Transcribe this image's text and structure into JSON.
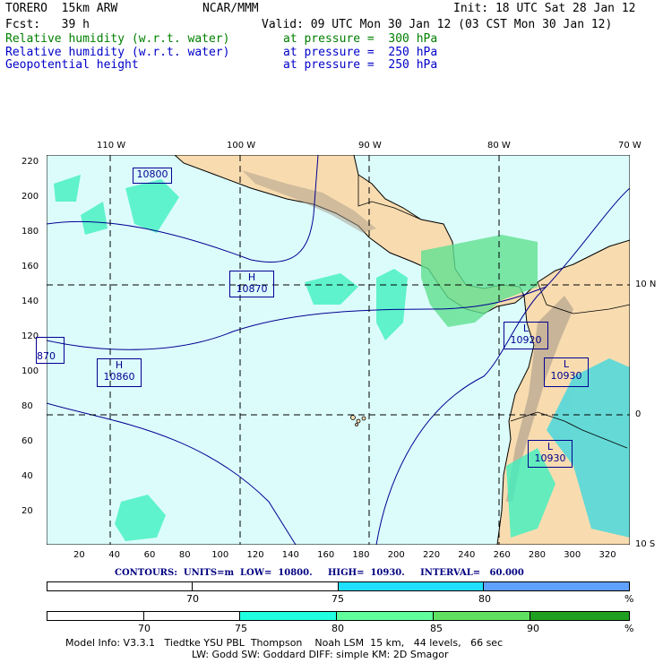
{
  "header": {
    "model": "TORERO  15km ARW",
    "center": "NCAR/MMM",
    "init": "Init: 18 UTC Sat 28 Jan 12",
    "fcst": "Fcst:   39 h",
    "valid": "Valid: 09 UTC Mon 30 Jan 12 (03 CST Mon 30 Jan 12)"
  },
  "fields": [
    {
      "name": "Relative humidity (w.r.t. water)",
      "level": "at pressure =  300 hPa",
      "color": "#008000"
    },
    {
      "name": "Relative humidity (w.r.t. water)",
      "level": "at pressure =  250 hPa",
      "color": "#0000c8"
    },
    {
      "name": "Geopotential height",
      "level": "at pressure =  250 hPa",
      "color": "#0000c8"
    }
  ],
  "map": {
    "lon_labels": [
      "110 W",
      "100 W",
      "90 W",
      "80 W",
      "70 W"
    ],
    "lat_labels": [
      "10 N",
      "0",
      "10 S"
    ],
    "y_ticks": [
      "220",
      "200",
      "180",
      "160",
      "140",
      "120",
      "100",
      "80",
      "60",
      "40",
      "20"
    ],
    "x_ticks": [
      "20",
      "40",
      "60",
      "80",
      "100",
      "120",
      "140",
      "160",
      "180",
      "200",
      "220",
      "240",
      "260",
      "280",
      "300",
      "320"
    ],
    "centers": [
      {
        "type": "H",
        "value": "10870"
      },
      {
        "type": "H",
        "value": "10860"
      },
      {
        "type": "L",
        "value": "10920"
      },
      {
        "type": "L",
        "value": "10930"
      },
      {
        "type": "L",
        "value": "10930"
      },
      {
        "type": "",
        "value": "10800"
      },
      {
        "type": "",
        "value": "870"
      }
    ],
    "colors": {
      "ocean": "#dcfcfc",
      "land": "#f8dcb0"
    }
  },
  "contours_info": "CONTOURS:  UNITS=m  LOW=  10800.     HIGH=  10930.     INTERVAL=   60.000",
  "legend250": {
    "labels": [
      "70",
      "75",
      "80",
      "%"
    ],
    "colors": [
      "#ffffff",
      "#ffffff",
      "#20e0ff",
      "#60a0ff"
    ]
  },
  "legend300": {
    "labels": [
      "70",
      "75",
      "80",
      "85",
      "90",
      "%"
    ],
    "colors": [
      "#ffffff",
      "#ffffff",
      "#20ffe0",
      "#60ff9c",
      "#60e060",
      "#20a020"
    ]
  },
  "footer": {
    "line1": "Model Info: V3.3.1   Tiedtke YSU PBL  Thompson    Noah LSM  15 km,   44 levels,   66 sec",
    "line2": "LW: Godd SW: Goddard DIFF: simple KM: 2D Smagor"
  }
}
